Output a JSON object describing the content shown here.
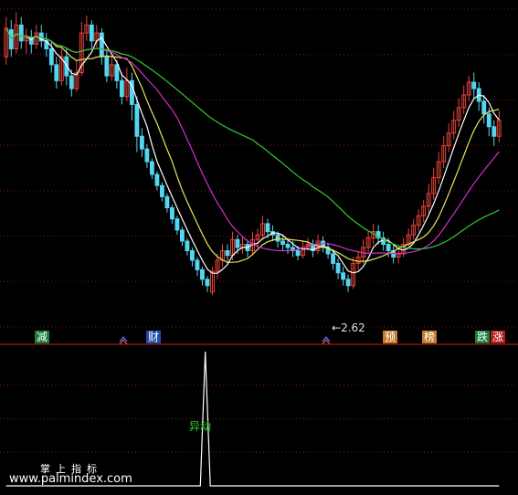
{
  "colors": {
    "up": "#e8443a",
    "down": "#54d6f0",
    "ma_white": "#ffffff",
    "ma_yellow": "#e8e85a",
    "ma_magenta": "#d030d0",
    "ma_green": "#33c933",
    "grid": "#8a1515",
    "divider": "#c81e1e"
  },
  "signals": [
    {
      "label": "减",
      "bg": "#1c7a3a",
      "fg": "#ffffff"
    },
    {
      "label": "财",
      "bg": "#1f4ea8",
      "fg": "#ffffff"
    },
    {
      "label": "预",
      "bg": "#c07a28",
      "fg": "#ffffff"
    },
    {
      "label": "榜",
      "bg": "#c07a28",
      "fg": "#ffffff"
    },
    {
      "label": "跌",
      "bg": "#1c7a3a",
      "fg": "#ffffff"
    },
    {
      "label": "涨",
      "bg": "#b01a1a",
      "fg": "#ffffff"
    }
  ],
  "annotations": {
    "low_price": "2.62",
    "spike_label": "异动"
  },
  "watermark": {
    "line1": "掌上指标",
    "line2": "www.palmindex.com"
  },
  "chart_data": [
    {
      "type": "candlestick",
      "title": "",
      "ylim": [
        2.4,
        4.4
      ],
      "ma_series": [
        {
          "name": "",
          "color": "white"
        },
        {
          "name": "",
          "color": "yellow"
        },
        {
          "name": "",
          "color": "magenta"
        },
        {
          "name": "",
          "color": "green"
        }
      ],
      "candles": [
        [
          4.1,
          4.28,
          4.35,
          4.05
        ],
        [
          4.27,
          4.15,
          4.33,
          4.1
        ],
        [
          4.15,
          4.3,
          4.38,
          4.12
        ],
        [
          4.3,
          4.2,
          4.35,
          4.15
        ],
        [
          4.2,
          4.22,
          4.28,
          4.12
        ],
        [
          4.22,
          4.18,
          4.27,
          4.12
        ],
        [
          4.18,
          4.25,
          4.3,
          4.15
        ],
        [
          4.25,
          4.2,
          4.3,
          4.16
        ],
        [
          4.2,
          4.15,
          4.25,
          4.1
        ],
        [
          4.15,
          4.05,
          4.2,
          4.0
        ],
        [
          4.05,
          3.95,
          4.1,
          3.9
        ],
        [
          3.95,
          4.1,
          4.15,
          3.92
        ],
        [
          4.1,
          3.98,
          4.15,
          3.92
        ],
        [
          3.98,
          3.9,
          4.02,
          3.85
        ],
        [
          3.9,
          4.0,
          4.08,
          3.88
        ],
        [
          4.0,
          4.25,
          4.32,
          3.98
        ],
        [
          4.25,
          4.3,
          4.36,
          4.2
        ],
        [
          4.3,
          4.2,
          4.33,
          4.15
        ],
        [
          4.2,
          4.25,
          4.3,
          4.16
        ],
        [
          4.25,
          4.1,
          4.28,
          4.05
        ],
        [
          4.1,
          3.98,
          4.15,
          3.94
        ],
        [
          3.98,
          4.05,
          4.1,
          3.95
        ],
        [
          4.05,
          3.95,
          4.08,
          3.9
        ],
        [
          3.95,
          3.85,
          4.0,
          3.8
        ],
        [
          3.85,
          3.95,
          4.03,
          3.82
        ],
        [
          3.95,
          3.8,
          4.0,
          3.7
        ],
        [
          3.8,
          3.6,
          3.85,
          3.5
        ],
        [
          3.6,
          3.52,
          3.65,
          3.47
        ],
        [
          3.52,
          3.44,
          3.55,
          3.4
        ],
        [
          3.44,
          3.36,
          3.46,
          3.33
        ],
        [
          3.36,
          3.29,
          3.38,
          3.26
        ],
        [
          3.29,
          3.22,
          3.31,
          3.19
        ],
        [
          3.22,
          3.15,
          3.24,
          3.12
        ],
        [
          3.15,
          3.08,
          3.17,
          3.05
        ],
        [
          3.08,
          3.01,
          3.1,
          2.98
        ],
        [
          3.01,
          2.94,
          3.03,
          2.91
        ],
        [
          2.94,
          2.88,
          2.96,
          2.85
        ],
        [
          2.88,
          2.82,
          2.9,
          2.78
        ],
        [
          2.82,
          2.76,
          2.84,
          2.72
        ],
        [
          2.76,
          2.7,
          2.78,
          2.66
        ],
        [
          2.7,
          2.66,
          2.72,
          2.62
        ],
        [
          2.62,
          2.75,
          2.78,
          2.6
        ],
        [
          2.75,
          2.82,
          2.86,
          2.7
        ],
        [
          2.82,
          2.88,
          2.92,
          2.78
        ],
        [
          2.88,
          2.85,
          2.92,
          2.8
        ],
        [
          2.85,
          2.95,
          3.0,
          2.82
        ],
        [
          2.95,
          2.9,
          2.98,
          2.86
        ],
        [
          2.9,
          2.92,
          2.97,
          2.86
        ],
        [
          2.92,
          2.88,
          2.95,
          2.84
        ],
        [
          2.88,
          2.95,
          3.0,
          2.85
        ],
        [
          2.95,
          2.98,
          3.02,
          2.9
        ],
        [
          2.98,
          3.05,
          3.1,
          2.95
        ],
        [
          3.05,
          3.0,
          3.08,
          2.96
        ],
        [
          3.0,
          2.98,
          3.04,
          2.94
        ],
        [
          2.98,
          2.94,
          3.0,
          2.9
        ],
        [
          2.94,
          2.92,
          2.98,
          2.88
        ],
        [
          2.92,
          2.9,
          2.96,
          2.86
        ],
        [
          2.9,
          2.88,
          2.94,
          2.84
        ],
        [
          2.88,
          2.85,
          2.91,
          2.82
        ],
        [
          2.85,
          2.9,
          2.94,
          2.83
        ],
        [
          2.9,
          2.92,
          2.96,
          2.88
        ],
        [
          2.92,
          2.88,
          2.95,
          2.84
        ],
        [
          2.88,
          2.94,
          2.98,
          2.86
        ],
        [
          2.94,
          2.9,
          2.97,
          2.87
        ],
        [
          2.9,
          2.86,
          2.93,
          2.83
        ],
        [
          2.86,
          2.8,
          2.89,
          2.76
        ],
        [
          2.8,
          2.74,
          2.83,
          2.7
        ],
        [
          2.74,
          2.7,
          2.78,
          2.66
        ],
        [
          2.7,
          2.66,
          2.73,
          2.62
        ],
        [
          2.66,
          2.8,
          2.84,
          2.64
        ],
        [
          2.8,
          2.84,
          2.88,
          2.76
        ],
        [
          2.84,
          2.9,
          2.95,
          2.8
        ],
        [
          2.9,
          2.96,
          3.0,
          2.86
        ],
        [
          2.96,
          3.0,
          3.05,
          2.92
        ],
        [
          3.0,
          2.96,
          3.04,
          2.92
        ],
        [
          2.96,
          2.92,
          3.0,
          2.88
        ],
        [
          2.92,
          2.88,
          2.96,
          2.84
        ],
        [
          2.88,
          2.84,
          2.92,
          2.8
        ],
        [
          2.84,
          2.86,
          2.9,
          2.8
        ],
        [
          2.86,
          2.92,
          2.96,
          2.84
        ],
        [
          2.92,
          2.98,
          3.02,
          2.9
        ],
        [
          2.98,
          3.04,
          3.08,
          2.95
        ],
        [
          3.04,
          3.1,
          3.14,
          3.0
        ],
        [
          3.1,
          3.16,
          3.2,
          3.06
        ],
        [
          3.16,
          3.24,
          3.3,
          3.12
        ],
        [
          3.24,
          3.34,
          3.4,
          3.2
        ],
        [
          3.34,
          3.44,
          3.5,
          3.3
        ],
        [
          3.44,
          3.54,
          3.6,
          3.4
        ],
        [
          3.54,
          3.62,
          3.68,
          3.5
        ],
        [
          3.62,
          3.7,
          3.76,
          3.58
        ],
        [
          3.7,
          3.78,
          3.84,
          3.66
        ],
        [
          3.78,
          3.86,
          3.92,
          3.74
        ],
        [
          3.86,
          3.94,
          3.98,
          3.82
        ],
        [
          3.94,
          3.9,
          4.0,
          3.84
        ],
        [
          3.9,
          3.82,
          3.94,
          3.76
        ],
        [
          3.82,
          3.74,
          3.86,
          3.68
        ],
        [
          3.74,
          3.66,
          3.78,
          3.6
        ],
        [
          3.66,
          3.6,
          3.7,
          3.54
        ],
        [
          3.6,
          3.7,
          3.76,
          3.56
        ]
      ]
    },
    {
      "type": "line",
      "title": "",
      "ylim": [
        0,
        100
      ],
      "values": [
        0,
        0,
        0,
        0,
        0,
        0,
        0,
        0,
        0,
        0,
        0,
        0,
        0,
        0,
        0,
        0,
        0,
        0,
        0,
        0,
        0,
        0,
        0,
        0,
        0,
        0,
        0,
        0,
        0,
        0,
        0,
        0,
        0,
        0,
        0,
        0,
        0,
        0,
        0,
        0,
        100,
        0,
        0,
        0,
        0,
        0,
        0,
        0,
        0,
        0,
        0,
        0,
        0,
        0,
        0,
        0,
        0,
        0,
        0,
        0,
        0,
        0,
        0,
        0,
        0,
        0,
        0,
        0,
        0,
        0,
        0,
        0,
        0,
        0,
        0,
        0,
        0,
        0,
        0,
        0,
        0,
        0,
        0,
        0,
        0,
        0,
        0,
        0,
        0,
        0,
        0,
        0,
        0,
        0,
        0,
        0,
        0,
        0,
        0,
        0
      ]
    }
  ]
}
